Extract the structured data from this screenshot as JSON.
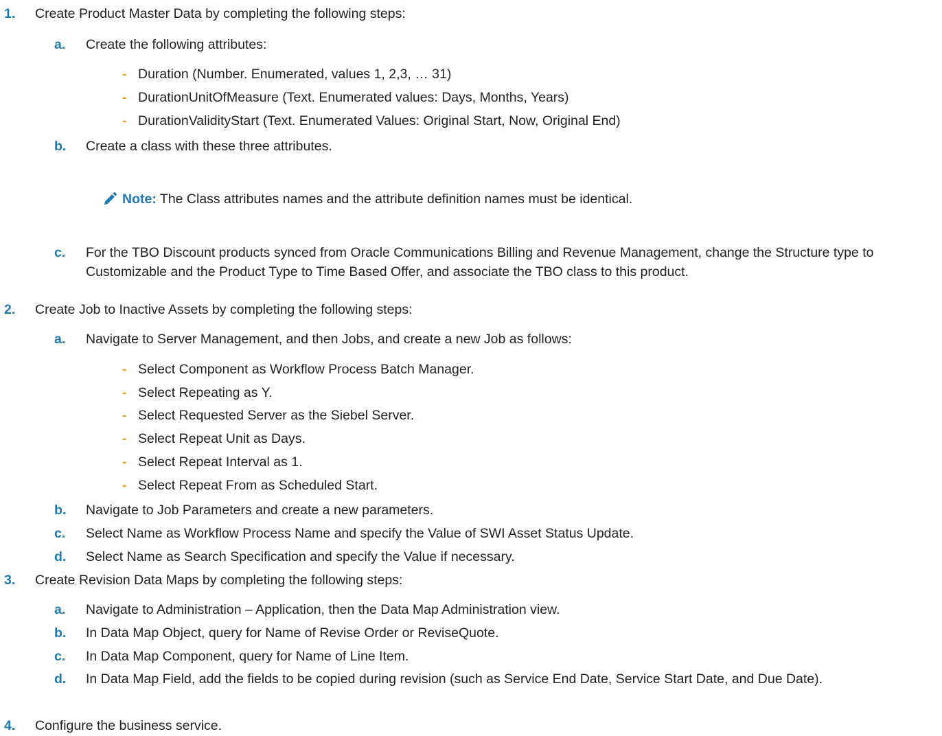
{
  "colors": {
    "accent": "#1f79b3",
    "dash": "#f0a020",
    "text": "#222222"
  },
  "steps": [
    {
      "marker": "1.",
      "text": "Create Product Master Data by completing the following steps:",
      "substeps": [
        {
          "marker": "a.",
          "text": "Create the following attributes:",
          "bullets": [
            "Duration (Number. Enumerated, values 1, 2,3, … 31)",
            "DurationUnitOfMeasure (Text. Enumerated values: Days, Months, Years)",
            "DurationValidityStart (Text. Enumerated Values: Original Start, Now, Original End)"
          ]
        },
        {
          "marker": "b.",
          "text": "Create a class with these three attributes."
        },
        {
          "marker": "c.",
          "text": "For the TBO Discount products synced from Oracle Communications Billing and Revenue Management, change the Structure type to Customizable and the Product Type to Time Based Offer, and associate the TBO class to this product."
        }
      ],
      "note": {
        "icon": "pencil-icon",
        "label": "Note:",
        "text": "The Class attributes names and the attribute definition names must be identical."
      }
    },
    {
      "marker": "2.",
      "text": "Create Job to Inactive Assets by completing the following steps:",
      "substeps": [
        {
          "marker": "a.",
          "text": "Navigate to Server Management, and then Jobs, and create a new Job as follows:",
          "bullets": [
            "Select Component as Workflow Process Batch Manager.",
            "Select Repeating as Y.",
            "Select Requested Server as the Siebel Server.",
            "Select Repeat Unit as Days.",
            "Select Repeat Interval as 1.",
            "Select Repeat From as Scheduled Start."
          ]
        },
        {
          "marker": "b.",
          "text": "Navigate to Job Parameters and create a new parameters."
        },
        {
          "marker": "c.",
          "text": "Select Name as Workflow Process Name and specify the Value of SWI Asset Status Update."
        },
        {
          "marker": "d.",
          "text": "Select Name as Search Specification and specify the Value if necessary."
        }
      ]
    },
    {
      "marker": "3.",
      "text": "Create Revision Data Maps by completing the following steps:",
      "substeps": [
        {
          "marker": "a.",
          "text": "Navigate to Administration – Application, then the Data Map Administration view."
        },
        {
          "marker": "b.",
          "text": "In Data Map Object, query for Name of Revise Order or ReviseQuote."
        },
        {
          "marker": "c.",
          "text": "In Data Map Component, query for Name of Line Item."
        },
        {
          "marker": "d.",
          "text": "In Data Map Field, add the fields to be copied during revision (such as Service End Date, Service Start Date, and Due Date)."
        }
      ]
    },
    {
      "marker": "4.",
      "text": "Configure the business service."
    }
  ]
}
